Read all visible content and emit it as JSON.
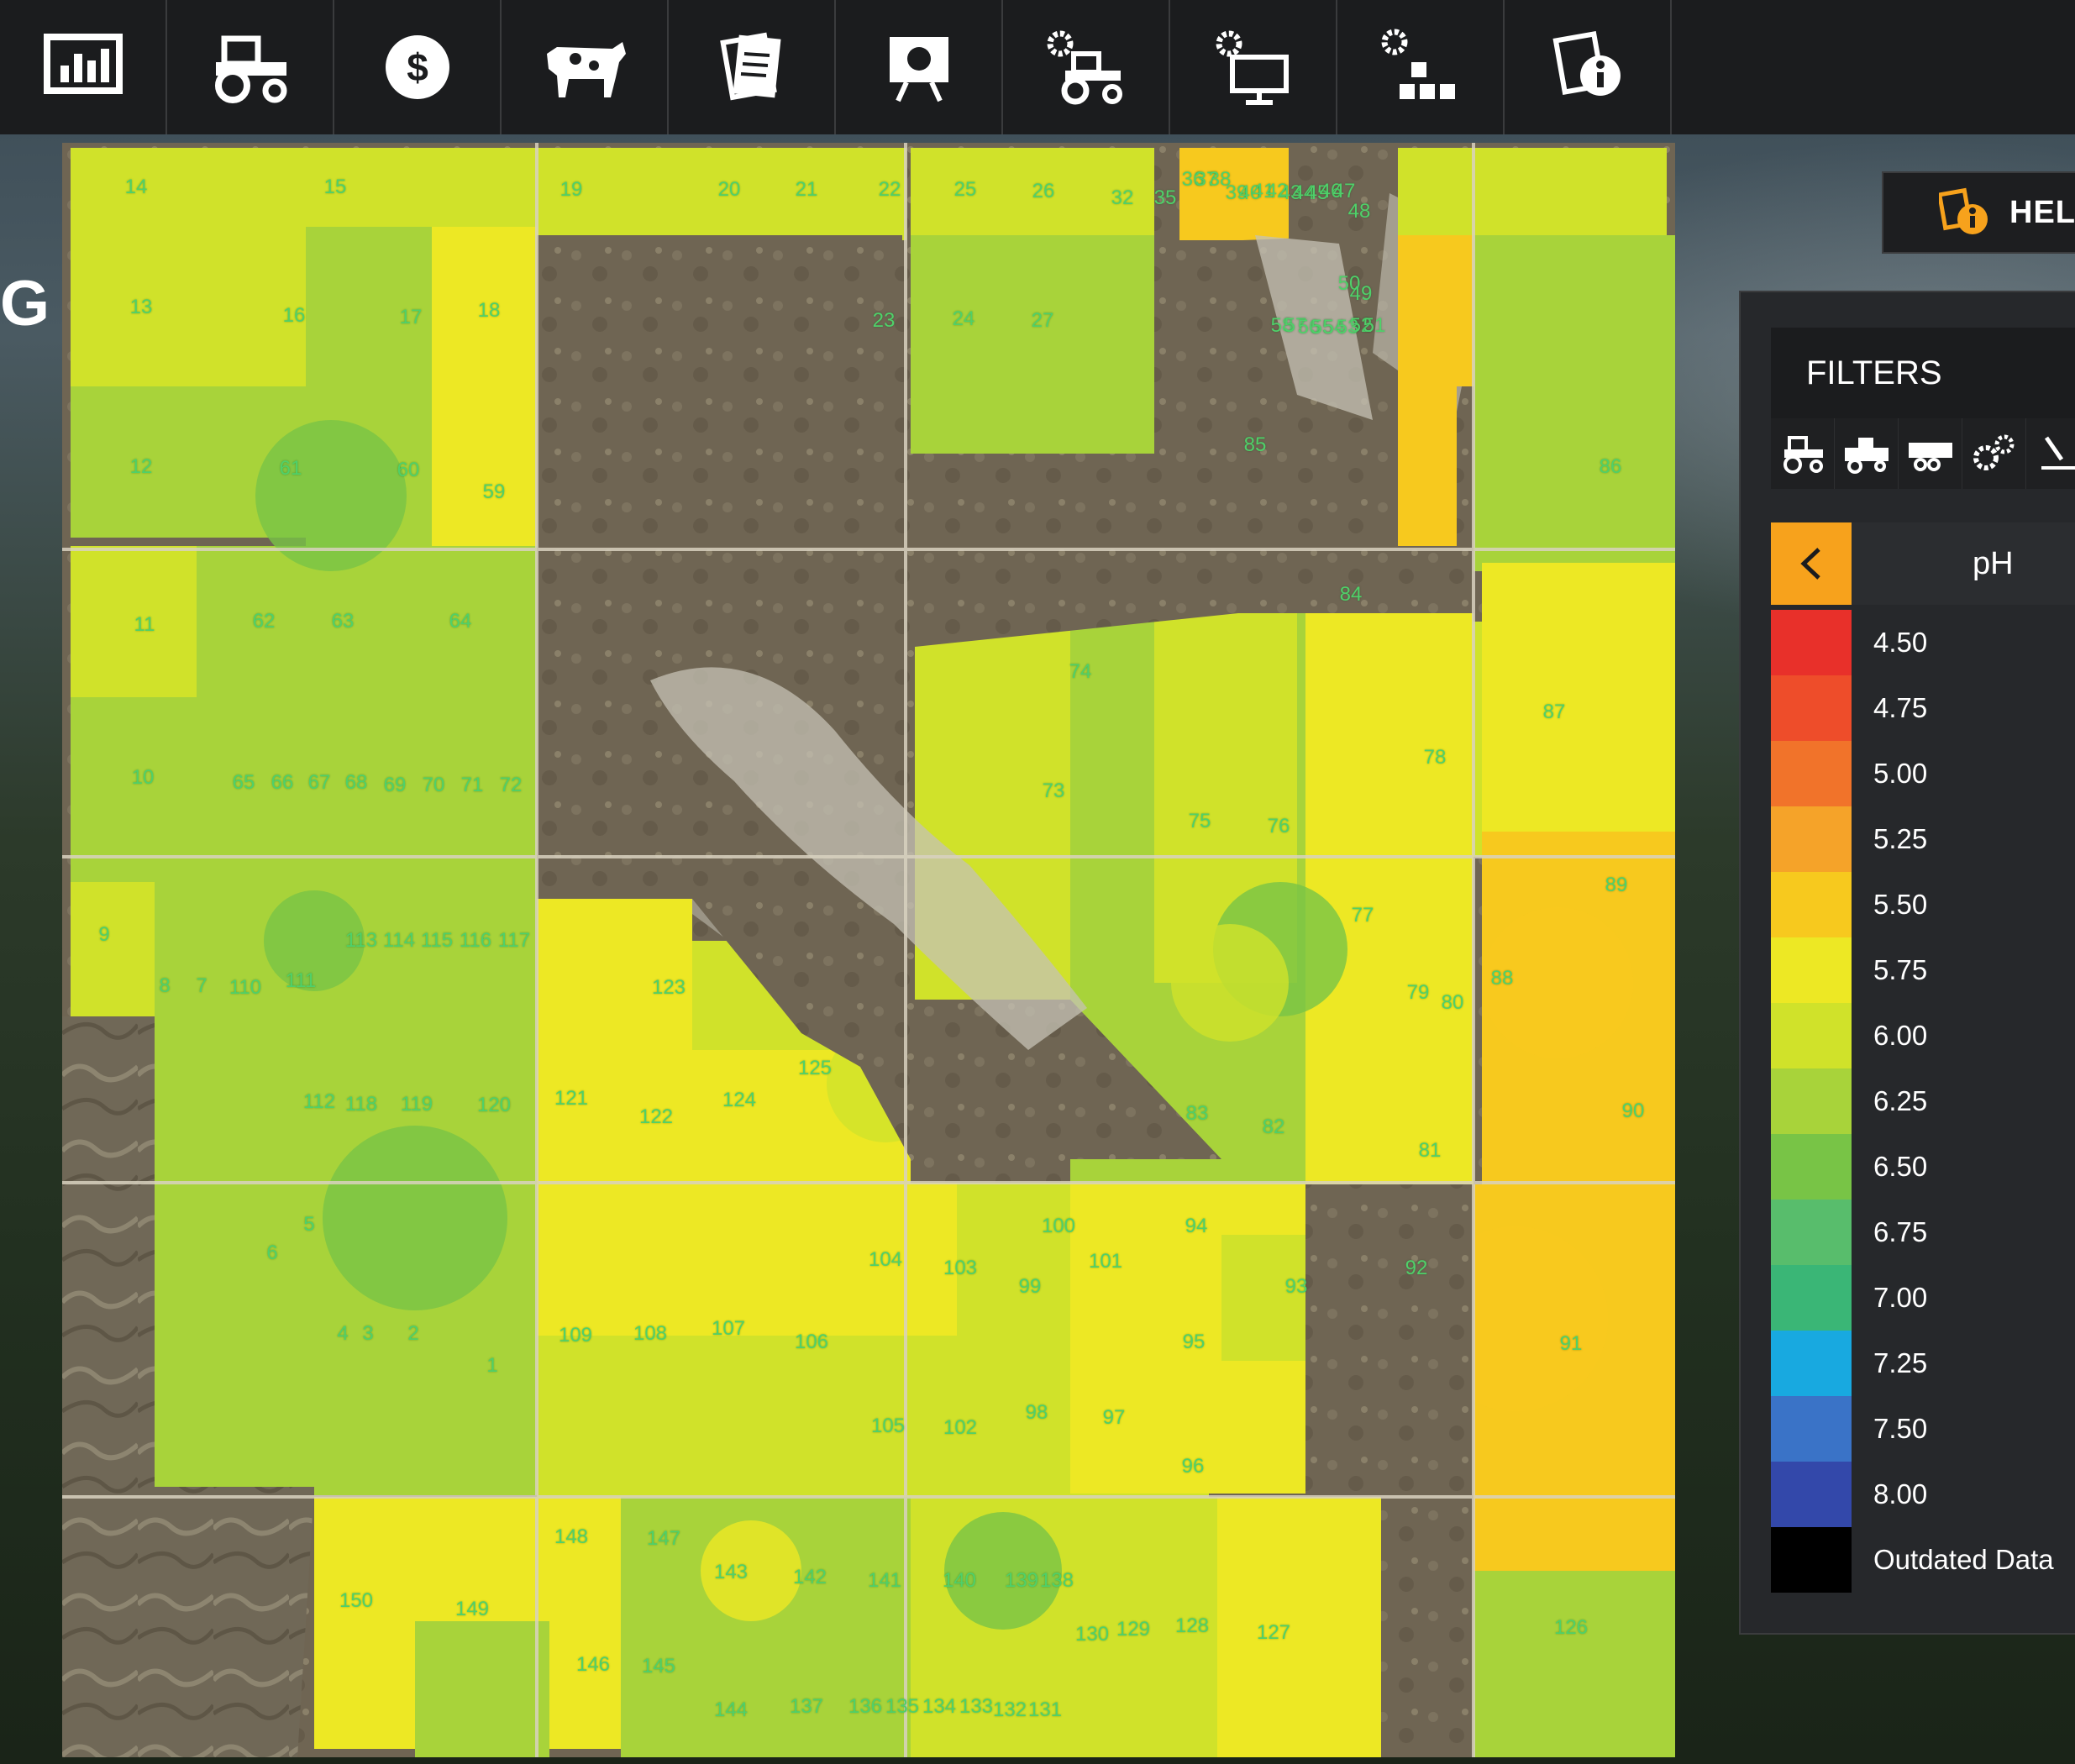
{
  "toolbar": {
    "items": [
      {
        "icon": "statistics-chart-icon"
      },
      {
        "icon": "tractor-icon"
      },
      {
        "icon": "dollar-icon"
      },
      {
        "icon": "cow-icon"
      },
      {
        "icon": "contracts-icon"
      },
      {
        "icon": "presentation-icon"
      },
      {
        "icon": "gear-tractor-icon"
      },
      {
        "icon": "gear-monitor-icon"
      },
      {
        "icon": "production-icon"
      },
      {
        "icon": "info-document-icon"
      }
    ]
  },
  "page_title_fragment": "G",
  "help": {
    "label": "HELP",
    "icon": "help-info-icon"
  },
  "filters": {
    "title": "FILTERS",
    "icons": [
      "tractor-icon",
      "harvester-icon",
      "trailer-icon",
      "gears-icon",
      "tool-icon"
    ]
  },
  "legend": {
    "title": "pH",
    "back_icon": "chevron-left-icon",
    "items": [
      {
        "label": "4.50",
        "color": "#e8302a"
      },
      {
        "label": "4.75",
        "color": "#ee4d2a"
      },
      {
        "label": "5.00",
        "color": "#f1732a"
      },
      {
        "label": "5.25",
        "color": "#f5a329"
      },
      {
        "label": "5.50",
        "color": "#f7c91e"
      },
      {
        "label": "5.75",
        "color": "#ede824"
      },
      {
        "label": "6.00",
        "color": "#d0e22a"
      },
      {
        "label": "6.25",
        "color": "#a8d33a"
      },
      {
        "label": "6.50",
        "color": "#78c446"
      },
      {
        "label": "6.75",
        "color": "#58bd6c"
      },
      {
        "label": "7.00",
        "color": "#3ab676"
      },
      {
        "label": "7.25",
        "color": "#18a9e0"
      },
      {
        "label": "7.50",
        "color": "#3a73c7"
      },
      {
        "label": "8.00",
        "color": "#3348aa"
      },
      {
        "label": "Outdated Data",
        "color": "#000000"
      }
    ]
  },
  "map": {
    "field_labels": [
      "14",
      "15",
      "19",
      "20",
      "21",
      "22",
      "25",
      "26",
      "32",
      "35",
      "36",
      "37",
      "38",
      "39",
      "40",
      "41",
      "42",
      "43",
      "44",
      "45",
      "46",
      "47",
      "48",
      "50",
      "49",
      "13",
      "16",
      "17",
      "18",
      "23",
      "24",
      "27",
      "58",
      "57",
      "56",
      "55",
      "54",
      "53",
      "52",
      "51",
      "85",
      "12",
      "61",
      "60",
      "59",
      "86",
      "11",
      "62",
      "63",
      "64",
      "84",
      "87",
      "74",
      "10",
      "65",
      "66",
      "67",
      "68",
      "69",
      "70",
      "71",
      "72",
      "73",
      "78",
      "75",
      "76",
      "89",
      "9",
      "113",
      "114",
      "115",
      "116",
      "117",
      "77",
      "8",
      "7",
      "110",
      "111",
      "123",
      "79",
      "80",
      "88",
      "125",
      "112",
      "118",
      "119",
      "120",
      "121",
      "122",
      "124",
      "83",
      "82",
      "90",
      "81",
      "5",
      "6",
      "100",
      "94",
      "104",
      "103",
      "101",
      "92",
      "99",
      "93",
      "4",
      "3",
      "2",
      "109",
      "108",
      "107",
      "106",
      "95",
      "91",
      "1",
      "105",
      "102",
      "98",
      "97",
      "96",
      "148",
      "147",
      "143",
      "142",
      "141",
      "140",
      "139",
      "138",
      "150",
      "149",
      "130",
      "129",
      "128",
      "127",
      "126",
      "146",
      "145",
      "144",
      "137",
      "136",
      "135",
      "134",
      "133",
      "132",
      "131"
    ]
  }
}
